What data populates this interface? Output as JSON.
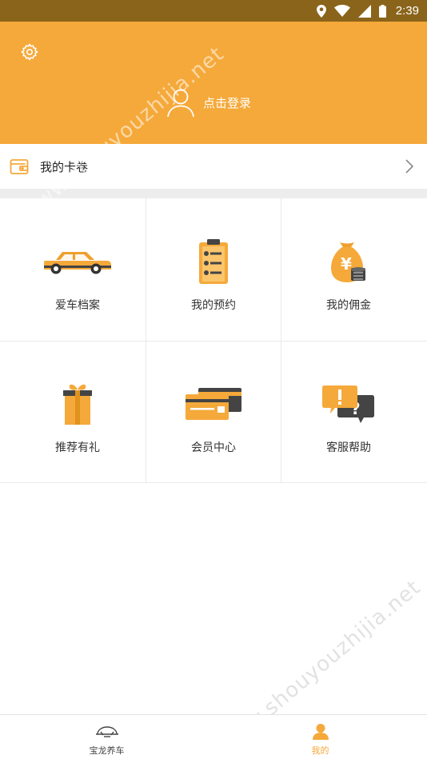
{
  "status_bar": {
    "time": "2:39",
    "icons": [
      "location-icon",
      "wifi-icon",
      "signal-icon",
      "battery-icon"
    ]
  },
  "header": {
    "background": "#f5a93a",
    "login_label": "点击登录",
    "settings_icon": "gear-icon",
    "avatar_icon": "person-outline-icon"
  },
  "card_row": {
    "label": "我的卡卷",
    "icon": "wallet-icon"
  },
  "grid": {
    "items": [
      {
        "label": "爱车档案",
        "icon": "car-icon"
      },
      {
        "label": "我的预约",
        "icon": "clipboard-icon"
      },
      {
        "label": "我的佣金",
        "icon": "money-bag-icon"
      },
      {
        "label": "推荐有礼",
        "icon": "gift-icon"
      },
      {
        "label": "会员中心",
        "icon": "member-card-icon"
      },
      {
        "label": "客服帮助",
        "icon": "help-chat-icon"
      }
    ]
  },
  "tabbar": {
    "tabs": [
      {
        "label": "宝龙养车",
        "icon": "car-front-icon",
        "active": false
      },
      {
        "label": "我的",
        "icon": "person-icon",
        "active": true
      }
    ],
    "active_color": "#f5a93a",
    "inactive_color": "#444444"
  },
  "watermark": {
    "text": "www.shouyouzhijia.net"
  }
}
